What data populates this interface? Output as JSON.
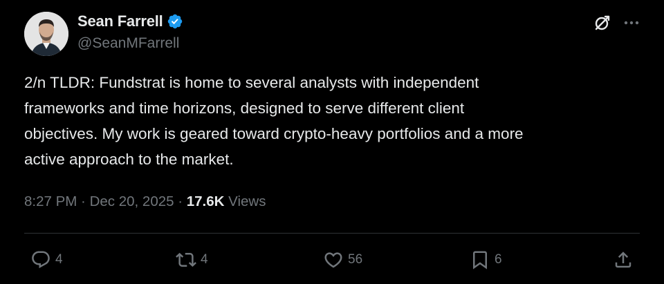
{
  "author": {
    "display_name": "Sean Farrell",
    "handle": "@SeanMFarrell",
    "verified": true
  },
  "icons": {
    "verified": "verified-badge-icon",
    "grok": "grok-icon",
    "more": "more-icon",
    "reply": "reply-icon",
    "retweet": "retweet-icon",
    "like": "heart-icon",
    "bookmark": "bookmark-icon",
    "share": "share-icon"
  },
  "tweet": {
    "text": "2/n TLDR: Fundstrat is home to several analysts with independent\nframeworks and time horizons, designed to serve different client\nobjectives. My work is geared toward crypto-heavy portfolios and a more\nactive approach to the market."
  },
  "meta": {
    "time": "8:27 PM",
    "separator": " · ",
    "date": "Dec 20, 2025",
    "separator2": " · ",
    "views_count": "17.6K",
    "views_label": " Views"
  },
  "actions": {
    "replies": "4",
    "retweets": "4",
    "likes": "56",
    "bookmarks": "6"
  },
  "colors": {
    "background": "#000000",
    "text_primary": "#e7e9ea",
    "text_secondary": "#71767b",
    "verified_blue": "#1d9bf0",
    "divider": "#2f3336"
  }
}
